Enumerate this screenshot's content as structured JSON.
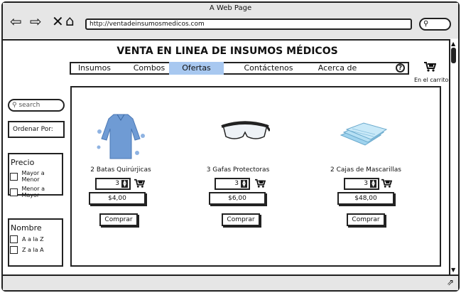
{
  "window": {
    "title": "A Web Page",
    "url": "http://ventadeinsumosmedicos.com"
  },
  "toolbar": {
    "back_icon": "⇦",
    "forward_icon": "⇨",
    "close_icon": "✕",
    "home_icon": "⌂",
    "search_icon": "⚲"
  },
  "page": {
    "title": "VENTA EN LINEA DE INSUMOS MÉDICOS",
    "cart_label": "En el carrito"
  },
  "menu": {
    "items": [
      "Insumos",
      "Combos",
      "Ofertas",
      "Contáctenos",
      "Acerca de"
    ],
    "active": "Ofertas",
    "help_icon": "?"
  },
  "sidebar": {
    "search_placeholder": "search",
    "order_label": "Ordenar Por:",
    "price": {
      "title": "Precio",
      "options": [
        "Mayor a Menor",
        "Menor a Mayor"
      ]
    },
    "name": {
      "title": "Nombre",
      "options": [
        "A a la Z",
        "Z a la A"
      ]
    }
  },
  "products": [
    {
      "name": "2 Batas Quirúrjicas",
      "qty": "3",
      "price": "$4,00",
      "buy": "Comprar",
      "image": "surgical-gown"
    },
    {
      "name": "3 Gafas Protectoras",
      "qty": "3",
      "price": "$6,00",
      "buy": "Comprar",
      "image": "safety-goggles"
    },
    {
      "name": "2 Cajas de Mascarillas",
      "qty": "3",
      "price": "$48,00",
      "buy": "Comprar",
      "image": "face-masks"
    }
  ],
  "colors": {
    "accent": "#a8c8f0",
    "border": "#222222",
    "chrome": "#e6e6e6"
  }
}
